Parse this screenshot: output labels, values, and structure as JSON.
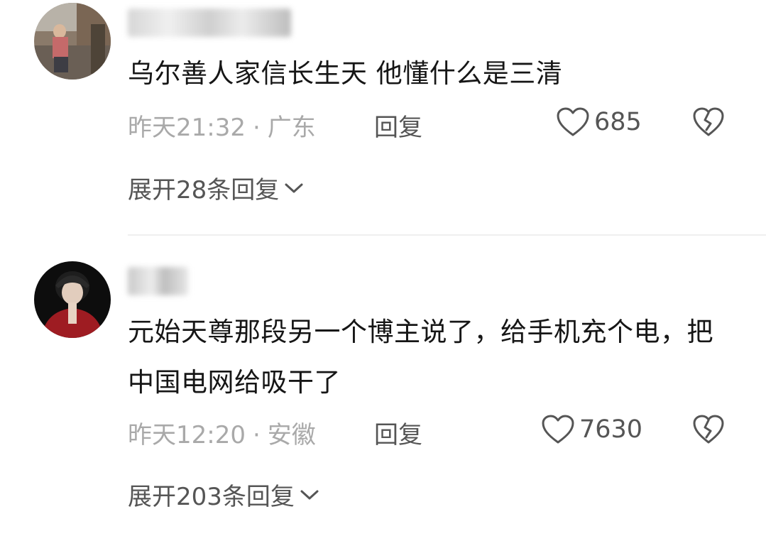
{
  "comments": [
    {
      "text": "乌尔善人家信长生天 他懂什么是三清",
      "time": "昨天21:32",
      "separator": "·",
      "location": "广东",
      "reply_label": "回复",
      "likes": "685",
      "expand_label": "展开28条回复",
      "like_icon": "heart-outline-icon",
      "dislike_icon": "broken-heart-icon"
    },
    {
      "text": "元始天尊那段另一个博主说了，给手机充个电，把中国电网给吸干了",
      "time": "昨天12:20",
      "separator": "·",
      "location": "安徽",
      "reply_label": "回复",
      "likes": "7630",
      "expand_label": "展开203条回复",
      "like_icon": "heart-outline-icon",
      "dislike_icon": "broken-heart-icon"
    }
  ],
  "colors": {
    "meta_gray": "#a9a9a9",
    "action_gray": "#555555",
    "text": "#161616"
  }
}
